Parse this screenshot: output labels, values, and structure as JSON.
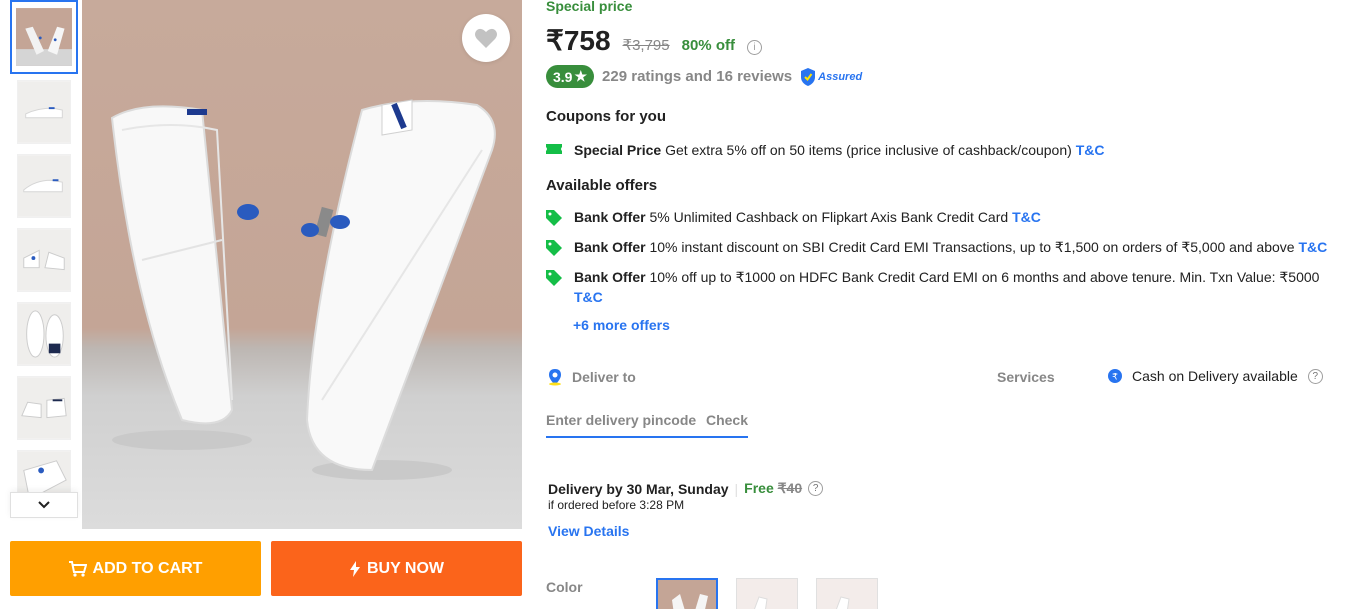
{
  "product": {
    "special_label": "Special price",
    "price": "₹758",
    "mrp": "₹3,795",
    "discount": "80% off",
    "rating": "3.9",
    "rating_star": "★",
    "ratings_text": "229 ratings and 16 reviews",
    "assured_label": "Assured"
  },
  "actions": {
    "add_to_cart": "ADD TO CART",
    "buy_now": "BUY NOW"
  },
  "coupons": {
    "heading": "Coupons for you",
    "items": [
      {
        "type": "Special Price",
        "text": "Get extra 5% off on 50 items (price inclusive of cashback/coupon)",
        "tc": "T&C"
      }
    ]
  },
  "offers": {
    "heading": "Available offers",
    "items": [
      {
        "type": "Bank Offer",
        "text": "5% Unlimited Cashback on Flipkart Axis Bank Credit Card",
        "tc": "T&C"
      },
      {
        "type": "Bank Offer",
        "text": "10% instant discount on SBI Credit Card EMI Transactions, up to ₹1,500 on orders of ₹5,000 and above",
        "tc": "T&C"
      },
      {
        "type": "Bank Offer",
        "text": "10% off up to ₹1000 on HDFC Bank Credit Card EMI on 6 months and above tenure. Min. Txn Value: ₹5000",
        "tc": "T&C"
      }
    ],
    "more": "+6 more offers"
  },
  "delivery": {
    "label": "Deliver to",
    "services_label": "Services",
    "cod": "Cash on Delivery available",
    "pincode_placeholder": "Enter delivery pincode",
    "check": "Check",
    "date_text": "Delivery by 30 Mar, Sunday",
    "separator": "|",
    "free": "Free",
    "charge": "₹40",
    "before": "if ordered before 3:28 PM",
    "view_details": "View Details"
  },
  "variants": {
    "color_label": "Color"
  },
  "icons": {
    "wishlist": "heart-icon",
    "cart": "cart-icon",
    "buy": "lightning-icon",
    "offer": "tag-icon",
    "coupon": "ticket-icon",
    "location": "location-pin-icon",
    "cod": "rupee-circle-icon",
    "thumb_scroll": "chevron-down-icon"
  },
  "colors": {
    "brand_blue": "#2874f0",
    "green": "#388e3c",
    "cart_orange": "#ff9f00",
    "buy_orange": "#fb641b"
  }
}
